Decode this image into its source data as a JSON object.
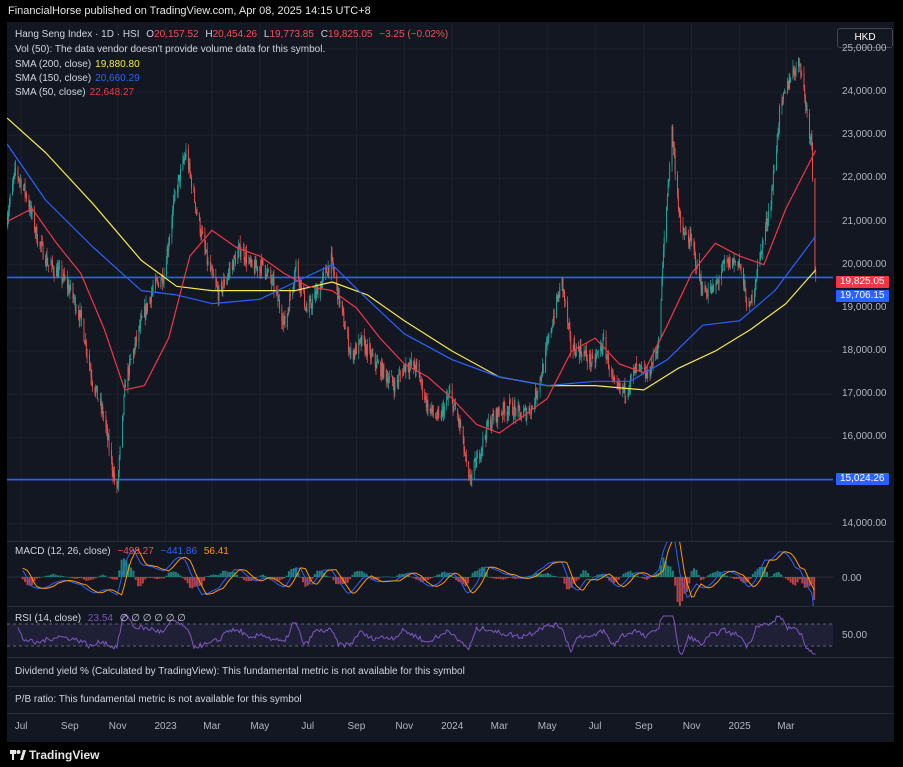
{
  "header": {
    "publisher_text": "FinancialHorse published on TradingView.com, Apr 08, 2025 14:15 UTC+8"
  },
  "currency_button": "HKD",
  "legend": {
    "symbol": "Hang Seng Index · 1D · HSI",
    "o_label": "O",
    "o_value": "20,157.52",
    "h_label": "H",
    "h_value": "20,454.26",
    "l_label": "L",
    "l_value": "19,773.85",
    "c_label": "C",
    "c_value": "19,825.05",
    "change": "−3.25 (−0.02%)",
    "vol_text": "Vol (50): The data vendor doesn't provide volume data for this symbol.",
    "sma200_label": "SMA (200, close)",
    "sma200_value": "19,880.80",
    "sma150_label": "SMA (150, close)",
    "sma150_value": "20,660.29",
    "sma50_label": "SMA (50, close)",
    "sma50_value": "22,648.27"
  },
  "colors": {
    "up": "#26a69a",
    "down": "#ef5350",
    "sma200": "#f7e94a",
    "sma150": "#2962ff",
    "sma50": "#f23645",
    "hline": "#2962ff",
    "rsi": "#7e57c2"
  },
  "macd_legend": {
    "label": "MACD (12, 26, close)",
    "v1": "−498.27",
    "v2": "−441.86",
    "v3": "56.41"
  },
  "rsi_legend": {
    "label": "RSI (14, close)",
    "v1": "23.54",
    "rest": "∅ ∅ ∅ ∅ ∅ ∅"
  },
  "macd_axis": "0.00",
  "rsi_axis": "50.00",
  "info": {
    "dividend": "Dividend yield % (Calculated by TradingView): This fundamental metric is not available for this symbol",
    "pb": "P/B ratio: This fundamental metric is not available for this symbol"
  },
  "footer": {
    "logo_text": "TradingView"
  },
  "price_tags": {
    "last": "19,825.05",
    "level_upper": "19,706.15",
    "level_lower": "15,024.26"
  },
  "chart_data": {
    "type": "candlestick",
    "y_ticks": [
      "25,000.00",
      "24,000.00",
      "23,000.00",
      "22,000.00",
      "21,000.00",
      "20,000.00",
      "19,000.00",
      "18,000.00",
      "17,000.00",
      "16,000.00",
      "15,000.00",
      "14,000.00"
    ],
    "y_tick_values": [
      25000,
      24000,
      23000,
      22000,
      21000,
      20000,
      19000,
      18000,
      17000,
      16000,
      15000,
      14000
    ],
    "ylim": [
      13600,
      25600
    ],
    "x_ticks": [
      "Jul",
      "Sep",
      "Nov",
      "2023",
      "Mar",
      "May",
      "Jul",
      "Sep",
      "Nov",
      "2024",
      "Mar",
      "May",
      "Jul",
      "Sep",
      "Nov",
      "2025",
      "Mar"
    ],
    "x_range": [
      "2022-06-13",
      "2025-04-30"
    ],
    "x_tick_dates": [
      "2022-07-01",
      "2022-09-01",
      "2022-11-01",
      "2023-01-01",
      "2023-03-01",
      "2023-05-01",
      "2023-07-01",
      "2023-09-01",
      "2023-11-01",
      "2024-01-01",
      "2024-03-01",
      "2024-05-01",
      "2024-07-01",
      "2024-09-01",
      "2024-11-01",
      "2025-01-01",
      "2025-03-01"
    ],
    "horizontal_levels": [
      19706.15,
      15024.26
    ],
    "price_path": [
      [
        "2022-06-13",
        21100
      ],
      [
        "2022-06-24",
        22200
      ],
      [
        "2022-07-08",
        21600
      ],
      [
        "2022-07-22",
        20600
      ],
      [
        "2022-08-05",
        20000
      ],
      [
        "2022-08-19",
        19800
      ],
      [
        "2022-09-02",
        19400
      ],
      [
        "2022-09-16",
        18700
      ],
      [
        "2022-09-30",
        17300
      ],
      [
        "2022-10-14",
        16500
      ],
      [
        "2022-10-31",
        14700
      ],
      [
        "2022-11-11",
        17300
      ],
      [
        "2022-11-30",
        18600
      ],
      [
        "2022-12-15",
        19400
      ],
      [
        "2022-12-30",
        19800
      ],
      [
        "2023-01-13",
        21600
      ],
      [
        "2023-01-27",
        22600
      ],
      [
        "2023-02-10",
        21200
      ],
      [
        "2023-02-24",
        20000
      ],
      [
        "2023-03-10",
        19300
      ],
      [
        "2023-03-24",
        19900
      ],
      [
        "2023-04-07",
        20400
      ],
      [
        "2023-04-21",
        19900
      ],
      [
        "2023-05-05",
        20000
      ],
      [
        "2023-05-19",
        19500
      ],
      [
        "2023-06-02",
        18600
      ],
      [
        "2023-06-16",
        20000
      ],
      [
        "2023-06-30",
        18900
      ],
      [
        "2023-07-14",
        19400
      ],
      [
        "2023-07-31",
        20100
      ],
      [
        "2023-08-11",
        19100
      ],
      [
        "2023-08-25",
        17900
      ],
      [
        "2023-09-08",
        18200
      ],
      [
        "2023-09-22",
        17800
      ],
      [
        "2023-10-06",
        17500
      ],
      [
        "2023-10-20",
        17200
      ],
      [
        "2023-11-03",
        17700
      ],
      [
        "2023-11-17",
        17600
      ],
      [
        "2023-12-01",
        16700
      ],
      [
        "2023-12-15",
        16400
      ],
      [
        "2023-12-29",
        17000
      ],
      [
        "2024-01-12",
        16200
      ],
      [
        "2024-01-22",
        14950
      ],
      [
        "2024-02-02",
        15500
      ],
      [
        "2024-02-16",
        16300
      ],
      [
        "2024-03-01",
        16600
      ],
      [
        "2024-03-15",
        16700
      ],
      [
        "2024-03-29",
        16500
      ],
      [
        "2024-04-12",
        16700
      ],
      [
        "2024-04-26",
        17650
      ],
      [
        "2024-05-10",
        18900
      ],
      [
        "2024-05-20",
        19600
      ],
      [
        "2024-05-31",
        18100
      ],
      [
        "2024-06-14",
        18000
      ],
      [
        "2024-06-28",
        17700
      ],
      [
        "2024-07-12",
        18200
      ],
      [
        "2024-07-26",
        17100
      ],
      [
        "2024-08-09",
        17100
      ],
      [
        "2024-08-23",
        17600
      ],
      [
        "2024-09-06",
        17400
      ],
      [
        "2024-09-20",
        18200
      ],
      [
        "2024-09-27",
        20600
      ],
      [
        "2024-10-07",
        23100
      ],
      [
        "2024-10-18",
        20800
      ],
      [
        "2024-11-01",
        20500
      ],
      [
        "2024-11-15",
        19400
      ],
      [
        "2024-11-29",
        19400
      ],
      [
        "2024-12-13",
        20000
      ],
      [
        "2024-12-31",
        20100
      ],
      [
        "2025-01-13",
        18900
      ],
      [
        "2025-01-27",
        20200
      ],
      [
        "2025-02-10",
        21500
      ],
      [
        "2025-02-21",
        23500
      ],
      [
        "2025-03-07",
        24400
      ],
      [
        "2025-03-19",
        24700
      ],
      [
        "2025-03-31",
        23100
      ],
      [
        "2025-04-03",
        22850
      ],
      [
        "2025-04-07",
        20000
      ],
      [
        "2025-04-08",
        19825
      ]
    ],
    "sma50": [
      [
        "2022-06-13",
        21000
      ],
      [
        "2022-07-15",
        21300
      ],
      [
        "2022-08-15",
        20500
      ],
      [
        "2022-09-15",
        19800
      ],
      [
        "2022-10-15",
        18500
      ],
      [
        "2022-11-10",
        17100
      ],
      [
        "2022-12-05",
        17200
      ],
      [
        "2023-01-05",
        18300
      ],
      [
        "2023-02-01",
        20200
      ],
      [
        "2023-03-01",
        20800
      ],
      [
        "2023-04-01",
        20400
      ],
      [
        "2023-05-01",
        20200
      ],
      [
        "2023-06-01",
        19800
      ],
      [
        "2023-07-01",
        19500
      ],
      [
        "2023-08-01",
        19400
      ],
      [
        "2023-09-01",
        19000
      ],
      [
        "2023-10-01",
        18300
      ],
      [
        "2023-11-01",
        17700
      ],
      [
        "2023-12-01",
        17400
      ],
      [
        "2024-01-01",
        16900
      ],
      [
        "2024-02-01",
        16300
      ],
      [
        "2024-03-01",
        16100
      ],
      [
        "2024-04-01",
        16500
      ],
      [
        "2024-05-01",
        16900
      ],
      [
        "2024-06-01",
        18000
      ],
      [
        "2024-07-01",
        18300
      ],
      [
        "2024-08-01",
        17700
      ],
      [
        "2024-09-01",
        17500
      ],
      [
        "2024-10-01",
        18600
      ],
      [
        "2024-11-01",
        19800
      ],
      [
        "2024-12-01",
        20500
      ],
      [
        "2025-01-01",
        20200
      ],
      [
        "2025-02-01",
        20000
      ],
      [
        "2025-03-01",
        21300
      ],
      [
        "2025-04-08",
        22648
      ]
    ],
    "sma150": [
      [
        "2022-06-13",
        22800
      ],
      [
        "2022-08-01",
        21500
      ],
      [
        "2022-10-01",
        20400
      ],
      [
        "2022-12-01",
        19400
      ],
      [
        "2023-01-15",
        19300
      ],
      [
        "2023-03-01",
        19100
      ],
      [
        "2023-05-01",
        19200
      ],
      [
        "2023-06-15",
        19600
      ],
      [
        "2023-08-01",
        20000
      ],
      [
        "2023-09-15",
        19200
      ],
      [
        "2023-11-01",
        18400
      ],
      [
        "2024-01-01",
        17800
      ],
      [
        "2024-03-01",
        17400
      ],
      [
        "2024-05-01",
        17200
      ],
      [
        "2024-07-01",
        17300
      ],
      [
        "2024-08-15",
        17300
      ],
      [
        "2024-10-01",
        17800
      ],
      [
        "2024-11-15",
        18600
      ],
      [
        "2025-01-01",
        18700
      ],
      [
        "2025-02-15",
        19400
      ],
      [
        "2025-04-08",
        20660
      ]
    ],
    "sma200": [
      [
        "2022-06-13",
        23400
      ],
      [
        "2022-08-01",
        22600
      ],
      [
        "2022-10-01",
        21400
      ],
      [
        "2022-12-01",
        20100
      ],
      [
        "2023-01-15",
        19500
      ],
      [
        "2023-03-01",
        19400
      ],
      [
        "2023-05-01",
        19400
      ],
      [
        "2023-06-15",
        19400
      ],
      [
        "2023-08-01",
        19600
      ],
      [
        "2023-09-15",
        19300
      ],
      [
        "2023-11-01",
        18700
      ],
      [
        "2024-01-01",
        18000
      ],
      [
        "2024-03-01",
        17400
      ],
      [
        "2024-05-01",
        17200
      ],
      [
        "2024-07-01",
        17200
      ],
      [
        "2024-09-01",
        17100
      ],
      [
        "2024-10-15",
        17600
      ],
      [
        "2024-12-01",
        18000
      ],
      [
        "2025-01-15",
        18500
      ],
      [
        "2025-03-01",
        19100
      ],
      [
        "2025-04-08",
        19881
      ]
    ]
  }
}
